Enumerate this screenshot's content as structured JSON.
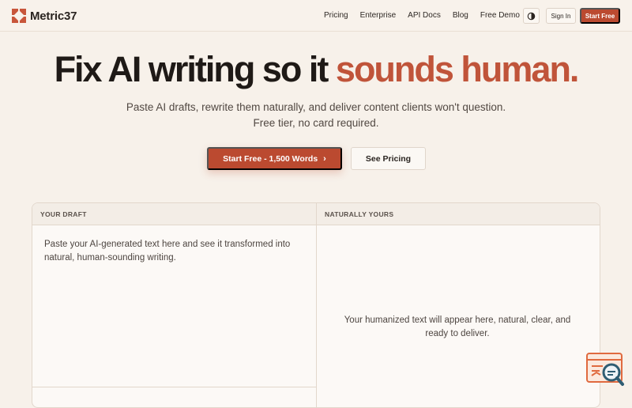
{
  "brand": {
    "name": "Metric37"
  },
  "nav": {
    "links": [
      "Pricing",
      "Enterprise",
      "API Docs",
      "Blog",
      "Free Demo"
    ],
    "sign_in": "Sign In",
    "start_free": "Start Free"
  },
  "hero": {
    "title_main": "Fix AI writing so it",
    "title_accent": "sounds human.",
    "subtitle_line1": "Paste AI drafts, rewrite them naturally, and deliver content clients won't question.",
    "subtitle_line2": "Free tier, no card required.",
    "cta_primary": "Start Free - 1,500 Words",
    "cta_secondary": "See Pricing"
  },
  "editor": {
    "left_label": "YOUR DRAFT",
    "right_label": "NATURALLY YOURS",
    "draft_placeholder": "Paste your AI-generated text here and see it transformed into natural, human-sounding writing.",
    "output_placeholder": "Your humanized text will appear here, natural, clear, and ready to deliver."
  },
  "colors": {
    "accent": "#c0543a",
    "button": "#bb4a30",
    "background": "#f7f1ea"
  },
  "icons": {
    "theme": "theme-toggle-icon",
    "chevron": "chevron-right-icon",
    "widget": "search-analytics-icon"
  }
}
